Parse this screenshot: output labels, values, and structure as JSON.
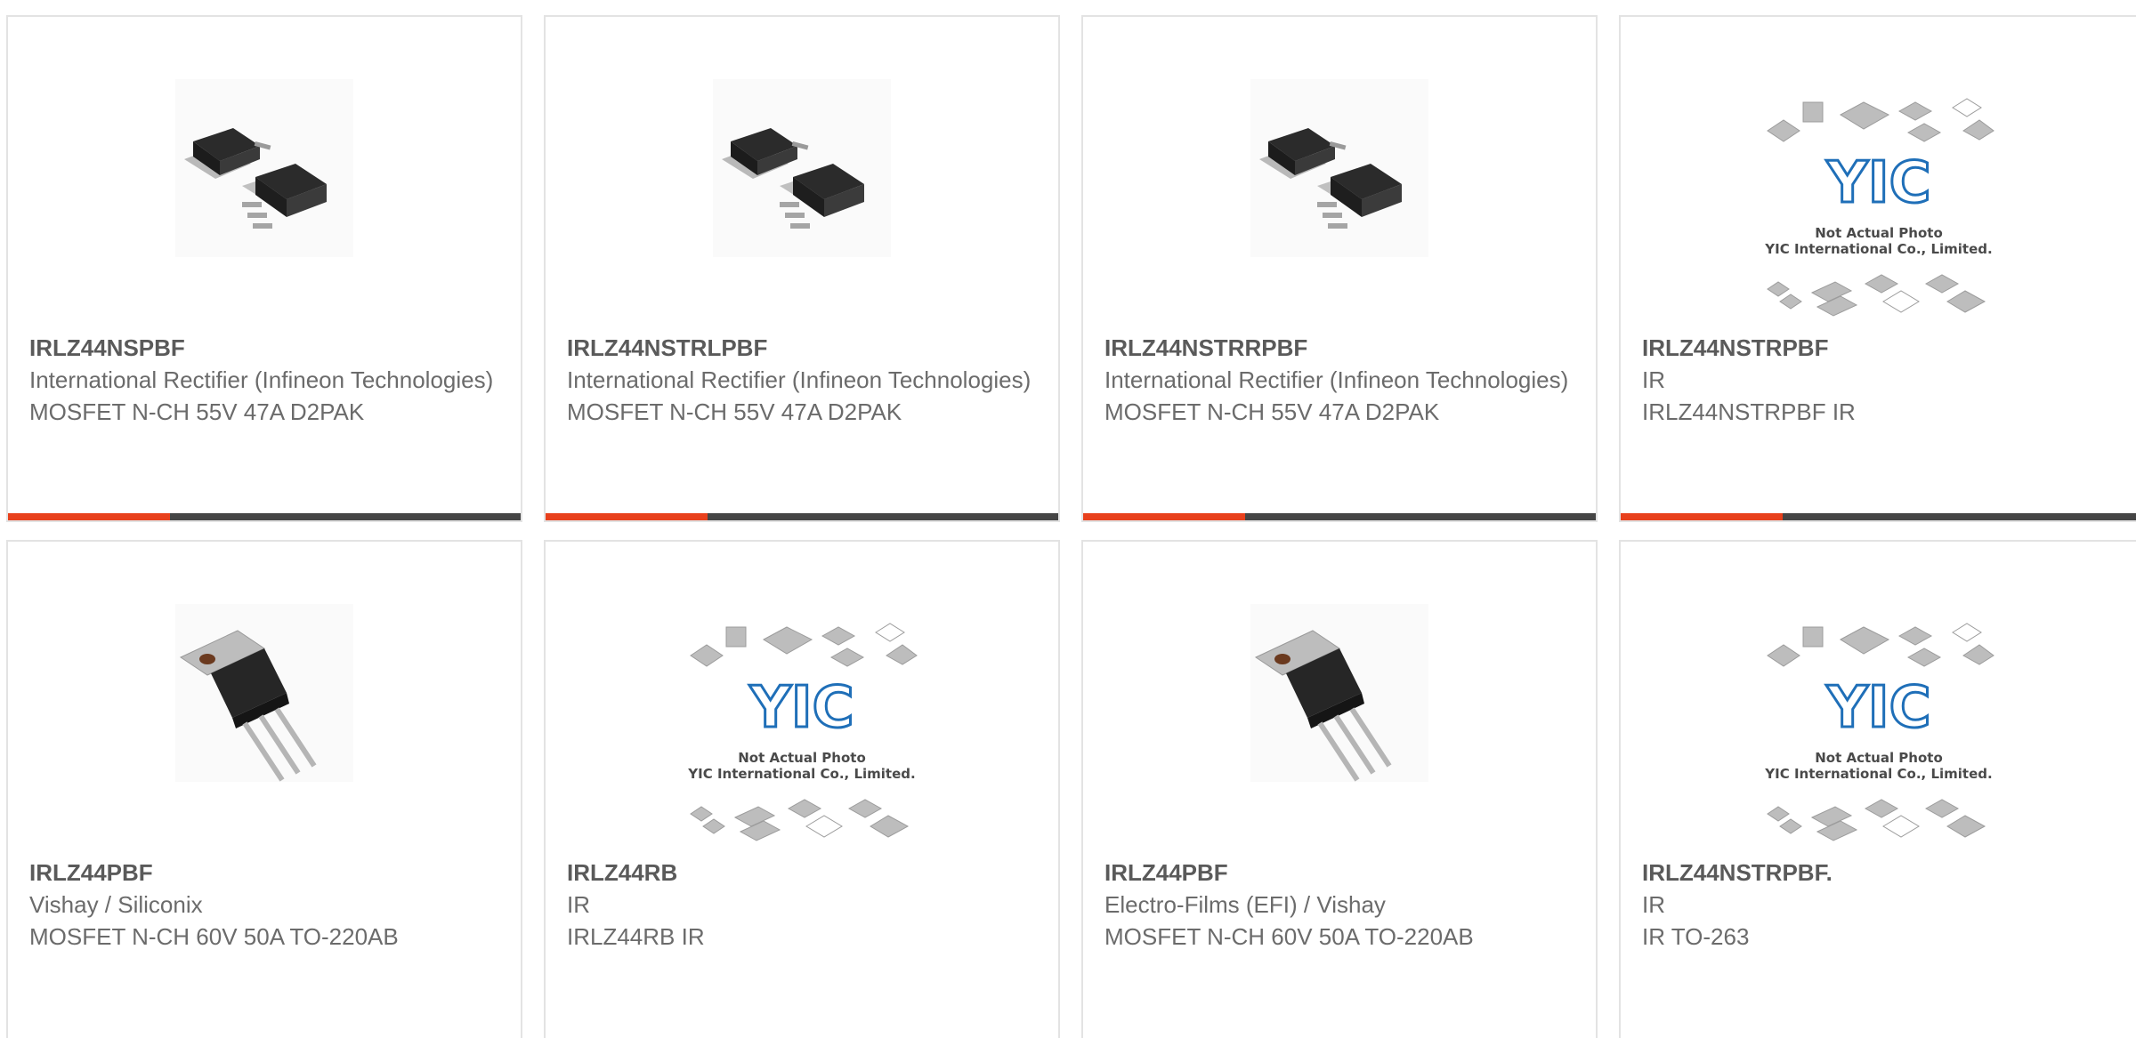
{
  "products": [
    {
      "part": "IRLZ44NSPBF",
      "manufacturer": "International Rectifier (Infineon Technologies)",
      "description": "MOSFET N-CH 55V 47A D2PAK",
      "image": "d2pak-package-icon"
    },
    {
      "part": "IRLZ44NSTRLPBF",
      "manufacturer": "International Rectifier (Infineon Technologies)",
      "description": "MOSFET N-CH 55V 47A D2PAK",
      "image": "d2pak-package-icon"
    },
    {
      "part": "IRLZ44NSTRRPBF",
      "manufacturer": "International Rectifier (Infineon Technologies)",
      "description": "MOSFET N-CH 55V 47A D2PAK",
      "image": "d2pak-package-icon"
    },
    {
      "part": "IRLZ44NSTRPBF",
      "manufacturer": "IR",
      "description": "IRLZ44NSTRPBF IR",
      "image": "not-actual-photo-placeholder"
    },
    {
      "part": "IRLZ44PBF",
      "manufacturer": "Vishay / Siliconix",
      "description": "MOSFET N-CH 60V 50A TO-220AB",
      "image": "to220-package-icon"
    },
    {
      "part": "IRLZ44RB",
      "manufacturer": "IR",
      "description": "IRLZ44RB IR",
      "image": "not-actual-photo-placeholder"
    },
    {
      "part": "IRLZ44PBF",
      "manufacturer": "Electro-Films (EFI) / Vishay",
      "description": "MOSFET N-CH 60V 50A TO-220AB",
      "image": "to220-package-icon"
    },
    {
      "part": "IRLZ44NSTRPBF.",
      "manufacturer": "IR",
      "description": "IR TO-263",
      "image": "not-actual-photo-placeholder"
    }
  ],
  "placeholder": {
    "logo": "YIC",
    "line1": "Not Actual Photo",
    "line2": "YIC International Co., Limited."
  },
  "colors": {
    "accent": "#e8401c",
    "bar": "#454545",
    "border": "#e3e3e3",
    "text": "#6b6b6b"
  }
}
